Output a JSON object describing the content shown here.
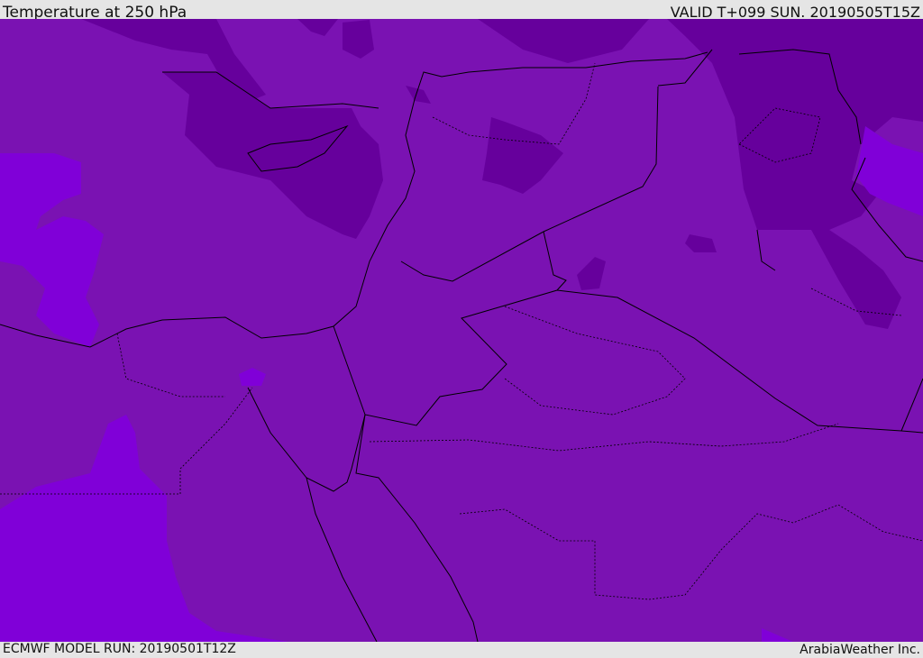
{
  "header": {
    "title": "Temperature at 250 hPa",
    "valid": "VALID T+099 SUN. 20190505T15Z"
  },
  "footer": {
    "model_run": "ECMWF MODEL RUN: 20190501T12Z",
    "credit": "ArabiaWeather Inc."
  },
  "colors": {
    "base": "#7a12b2",
    "cold": "#66009c",
    "warm": "#8000d8",
    "border": "#000000"
  }
}
